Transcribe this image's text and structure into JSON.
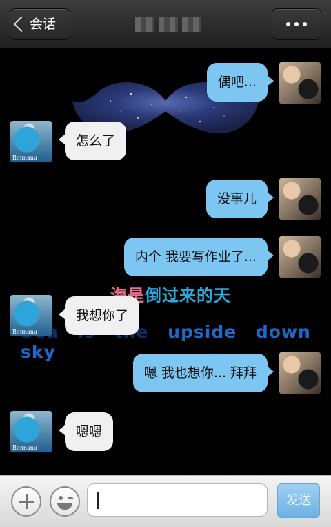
{
  "header": {
    "back_label": "会话",
    "more_icon": "more-dots-icon"
  },
  "background": {
    "lyric_cn_part1": "海是",
    "lyric_cn_part2": "倒过来的天",
    "lyric_en_dim1": "Sea",
    "lyric_en_dim2": "is",
    "lyric_en_dim3": "the",
    "lyric_en_word1": "upside",
    "lyric_en_word2": "down",
    "lyric_en_word3": "sky"
  },
  "contact": {
    "avatar_tag": "Bonnanu"
  },
  "messages": [
    {
      "side": "sent",
      "text": "偶吧..."
    },
    {
      "side": "recv",
      "text": "怎么了"
    },
    {
      "side": "sent",
      "text": "没事儿"
    },
    {
      "side": "sent",
      "text": "内个 我要写作业了..."
    },
    {
      "side": "recv",
      "text": "我想你了"
    },
    {
      "side": "sent",
      "text": "嗯 我也想你... 拜拜"
    },
    {
      "side": "recv",
      "text": "嗯嗯"
    }
  ],
  "input": {
    "value": "",
    "send_label": "发送"
  },
  "colors": {
    "sent_bubble": "#7ec6f2",
    "recv_bubble": "#f0f0f0",
    "header_bg": "#2e2e2e",
    "send_button": "#7fbde8"
  }
}
